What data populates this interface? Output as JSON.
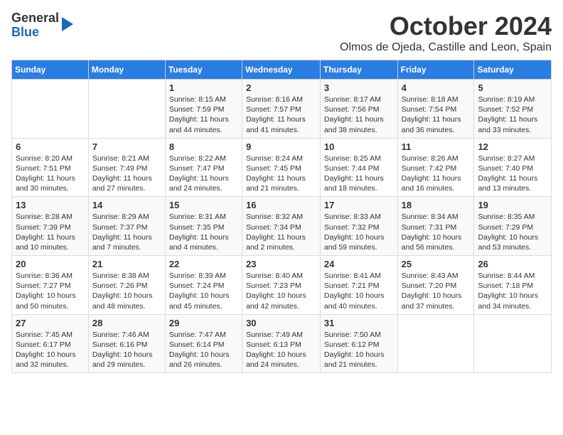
{
  "header": {
    "logo_general": "General",
    "logo_blue": "Blue",
    "month_title": "October 2024",
    "location": "Olmos de Ojeda, Castille and Leon, Spain"
  },
  "days_of_week": [
    "Sunday",
    "Monday",
    "Tuesday",
    "Wednesday",
    "Thursday",
    "Friday",
    "Saturday"
  ],
  "weeks": [
    [
      {
        "day": "",
        "info": ""
      },
      {
        "day": "",
        "info": ""
      },
      {
        "day": "1",
        "info": "Sunrise: 8:15 AM\nSunset: 7:59 PM\nDaylight: 11 hours and 44 minutes."
      },
      {
        "day": "2",
        "info": "Sunrise: 8:16 AM\nSunset: 7:57 PM\nDaylight: 11 hours and 41 minutes."
      },
      {
        "day": "3",
        "info": "Sunrise: 8:17 AM\nSunset: 7:56 PM\nDaylight: 11 hours and 38 minutes."
      },
      {
        "day": "4",
        "info": "Sunrise: 8:18 AM\nSunset: 7:54 PM\nDaylight: 11 hours and 36 minutes."
      },
      {
        "day": "5",
        "info": "Sunrise: 8:19 AM\nSunset: 7:52 PM\nDaylight: 11 hours and 33 minutes."
      }
    ],
    [
      {
        "day": "6",
        "info": "Sunrise: 8:20 AM\nSunset: 7:51 PM\nDaylight: 11 hours and 30 minutes."
      },
      {
        "day": "7",
        "info": "Sunrise: 8:21 AM\nSunset: 7:49 PM\nDaylight: 11 hours and 27 minutes."
      },
      {
        "day": "8",
        "info": "Sunrise: 8:22 AM\nSunset: 7:47 PM\nDaylight: 11 hours and 24 minutes."
      },
      {
        "day": "9",
        "info": "Sunrise: 8:24 AM\nSunset: 7:45 PM\nDaylight: 11 hours and 21 minutes."
      },
      {
        "day": "10",
        "info": "Sunrise: 8:25 AM\nSunset: 7:44 PM\nDaylight: 11 hours and 18 minutes."
      },
      {
        "day": "11",
        "info": "Sunrise: 8:26 AM\nSunset: 7:42 PM\nDaylight: 11 hours and 16 minutes."
      },
      {
        "day": "12",
        "info": "Sunrise: 8:27 AM\nSunset: 7:40 PM\nDaylight: 11 hours and 13 minutes."
      }
    ],
    [
      {
        "day": "13",
        "info": "Sunrise: 8:28 AM\nSunset: 7:39 PM\nDaylight: 11 hours and 10 minutes."
      },
      {
        "day": "14",
        "info": "Sunrise: 8:29 AM\nSunset: 7:37 PM\nDaylight: 11 hours and 7 minutes."
      },
      {
        "day": "15",
        "info": "Sunrise: 8:31 AM\nSunset: 7:35 PM\nDaylight: 11 hours and 4 minutes."
      },
      {
        "day": "16",
        "info": "Sunrise: 8:32 AM\nSunset: 7:34 PM\nDaylight: 11 hours and 2 minutes."
      },
      {
        "day": "17",
        "info": "Sunrise: 8:33 AM\nSunset: 7:32 PM\nDaylight: 10 hours and 59 minutes."
      },
      {
        "day": "18",
        "info": "Sunrise: 8:34 AM\nSunset: 7:31 PM\nDaylight: 10 hours and 56 minutes."
      },
      {
        "day": "19",
        "info": "Sunrise: 8:35 AM\nSunset: 7:29 PM\nDaylight: 10 hours and 53 minutes."
      }
    ],
    [
      {
        "day": "20",
        "info": "Sunrise: 8:36 AM\nSunset: 7:27 PM\nDaylight: 10 hours and 50 minutes."
      },
      {
        "day": "21",
        "info": "Sunrise: 8:38 AM\nSunset: 7:26 PM\nDaylight: 10 hours and 48 minutes."
      },
      {
        "day": "22",
        "info": "Sunrise: 8:39 AM\nSunset: 7:24 PM\nDaylight: 10 hours and 45 minutes."
      },
      {
        "day": "23",
        "info": "Sunrise: 8:40 AM\nSunset: 7:23 PM\nDaylight: 10 hours and 42 minutes."
      },
      {
        "day": "24",
        "info": "Sunrise: 8:41 AM\nSunset: 7:21 PM\nDaylight: 10 hours and 40 minutes."
      },
      {
        "day": "25",
        "info": "Sunrise: 8:43 AM\nSunset: 7:20 PM\nDaylight: 10 hours and 37 minutes."
      },
      {
        "day": "26",
        "info": "Sunrise: 8:44 AM\nSunset: 7:18 PM\nDaylight: 10 hours and 34 minutes."
      }
    ],
    [
      {
        "day": "27",
        "info": "Sunrise: 7:45 AM\nSunset: 6:17 PM\nDaylight: 10 hours and 32 minutes."
      },
      {
        "day": "28",
        "info": "Sunrise: 7:46 AM\nSunset: 6:16 PM\nDaylight: 10 hours and 29 minutes."
      },
      {
        "day": "29",
        "info": "Sunrise: 7:47 AM\nSunset: 6:14 PM\nDaylight: 10 hours and 26 minutes."
      },
      {
        "day": "30",
        "info": "Sunrise: 7:49 AM\nSunset: 6:13 PM\nDaylight: 10 hours and 24 minutes."
      },
      {
        "day": "31",
        "info": "Sunrise: 7:50 AM\nSunset: 6:12 PM\nDaylight: 10 hours and 21 minutes."
      },
      {
        "day": "",
        "info": ""
      },
      {
        "day": "",
        "info": ""
      }
    ]
  ]
}
